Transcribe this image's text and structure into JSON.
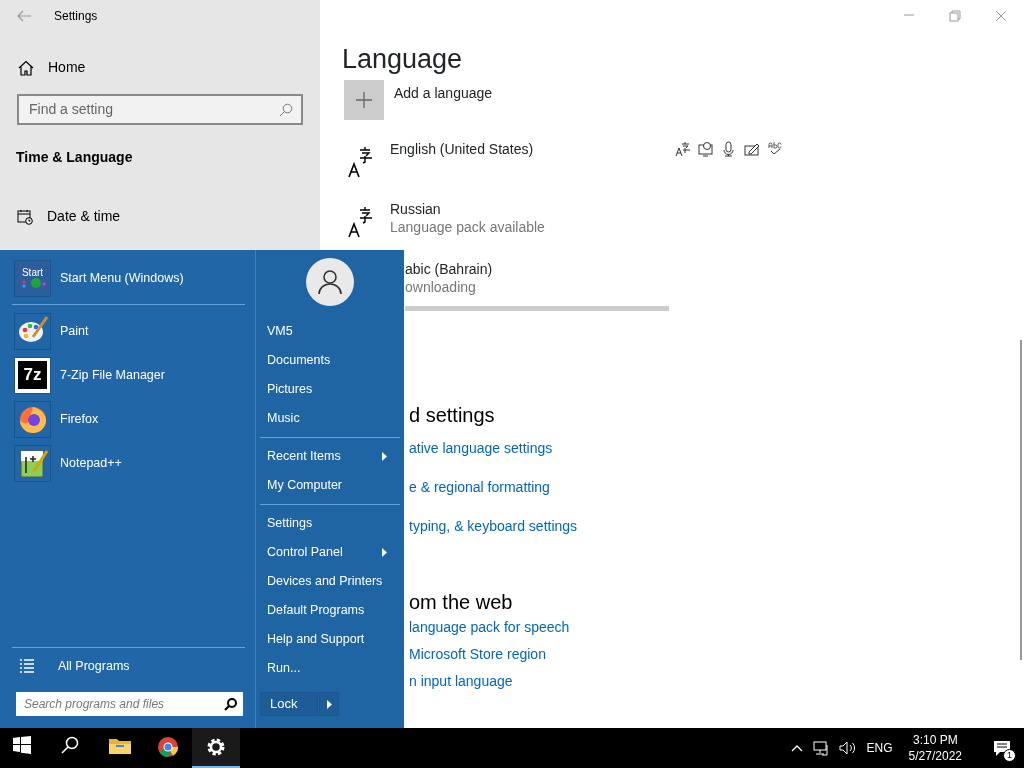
{
  "settings_window": {
    "title": "Settings",
    "sidebar": {
      "home": "Home",
      "search": {
        "placeholder": "Find a setting"
      },
      "section": "Time & Language",
      "items": [
        {
          "label": "Date & time"
        }
      ]
    },
    "content": {
      "title": "Language",
      "add_language": "Add a language",
      "languages": [
        {
          "kind": "installed",
          "name": "English (United States)"
        },
        {
          "kind": "available",
          "name": "Russian",
          "status": "Language pack available"
        },
        {
          "kind": "downloading",
          "name": "abic (Bahrain)",
          "status": "ownloading",
          "level": 1
        }
      ],
      "sections": [
        {
          "heading": "d settings",
          "links": [
            "ative language settings",
            "e & regional formatting",
            "typing, & keyboard settings"
          ]
        },
        {
          "heading": "om the web",
          "links": [
            "language pack for speech",
            "Microsoft Store region",
            "n input language"
          ]
        }
      ]
    }
  },
  "start_menu": {
    "programs": [
      {
        "kind": "startmenu",
        "label": "Start Menu (Windows)",
        "icon_text": "Start"
      },
      {
        "kind": "paint",
        "label": "Paint"
      },
      {
        "kind": "sevenzip",
        "label": "7-Zip File Manager",
        "icon_text": "7z"
      },
      {
        "kind": "firefox",
        "label": "Firefox"
      },
      {
        "kind": "notepad",
        "label": "Notepad++"
      }
    ],
    "all_programs": "All Programs",
    "search": {
      "placeholder": "Search programs and files"
    },
    "places": [
      [
        {
          "label": "VM5",
          "submenu": false
        },
        {
          "label": "Documents",
          "submenu": false
        },
        {
          "label": "Pictures",
          "submenu": false
        },
        {
          "label": "Music",
          "submenu": false
        }
      ],
      [
        {
          "label": "Recent Items",
          "submenu": true
        },
        {
          "label": "My Computer",
          "submenu": false
        }
      ],
      [
        {
          "label": "Settings",
          "submenu": false
        },
        {
          "label": "Control Panel",
          "submenu": true
        },
        {
          "label": "Devices and Printers",
          "submenu": false
        },
        {
          "label": "Default Programs",
          "submenu": false
        },
        {
          "label": "Help and Support",
          "submenu": false
        },
        {
          "label": "Run...",
          "submenu": false
        }
      ]
    ],
    "power_button": "Lock"
  },
  "taskbar": {
    "apps": [
      {
        "kind": "start",
        "active": false
      },
      {
        "kind": "search",
        "active": false
      },
      {
        "kind": "explorer",
        "active": false
      },
      {
        "kind": "chrome",
        "active": false
      },
      {
        "kind": "settings",
        "active": true
      }
    ],
    "language": "ENG",
    "time": "3:10 PM",
    "date": "5/27/2022",
    "notifications": "1"
  }
}
